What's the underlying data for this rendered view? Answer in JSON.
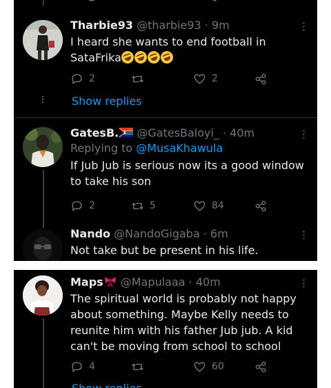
{
  "tweets": [
    {
      "display_name": "Tharbie93",
      "handle": "@tharbie93",
      "time": "· 9m",
      "text_line1": "I heard she wants to end football in",
      "text_line2": "SataFrika",
      "reply_count": "2",
      "retweet_count": "",
      "like_count": "2",
      "show_replies": "Show replies"
    },
    {
      "display_name": "GatesB.",
      "handle": "@GatesBaloyi_",
      "time": "· 40m",
      "replying_prefix": "Replying to",
      "replying_to": "@MusaKhawula",
      "text_line1": "If Jub Jub is serious now its a good window",
      "text_line2": "to take his son",
      "reply_count": "2",
      "retweet_count": "5",
      "like_count": "84"
    },
    {
      "display_name": "Nando",
      "handle": "@NandoGigaba",
      "time": "· 6m",
      "text_line1": "Not take but be present in his life."
    },
    {
      "display_name": "Maps",
      "handle": "@Mapulaaa",
      "time": "· 40m",
      "text_line1": "The spiritual world is probably not happy",
      "text_line2": "about something. Maybe Kelly needs to",
      "text_line3": "reunite him with his father Jub jub. A kid",
      "text_line4": "can't be moving from school to school",
      "reply_count": "4",
      "retweet_count": "",
      "like_count": "60",
      "show_replies": "Show replies"
    }
  ],
  "icons": {
    "reply": "reply-icon",
    "retweet": "retweet-icon",
    "like": "heart-icon",
    "share": "share-icon",
    "more": "more-dots-icon",
    "emoji": "rolling-on-floor-laughing-emoji"
  },
  "colors": {
    "background": "#000000",
    "text": "#e7e9ea",
    "muted": "#71767b",
    "accent": "#1d9bf0"
  }
}
